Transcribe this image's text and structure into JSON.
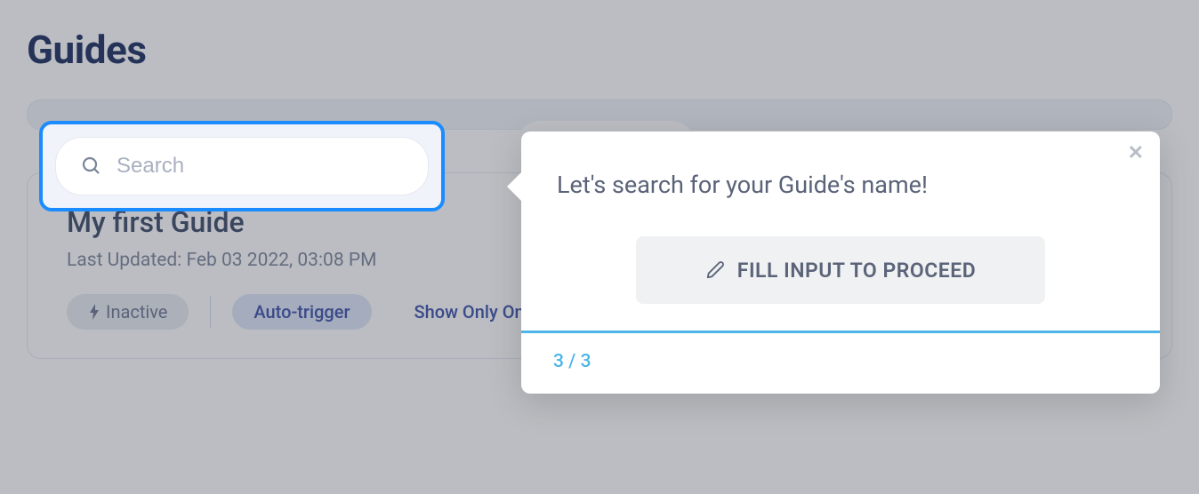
{
  "page": {
    "title": "Guides"
  },
  "search": {
    "placeholder": "Search"
  },
  "guide": {
    "title": "My first Guide",
    "meta_label": "Last Updated: Feb 03 2022, 03:08 PM",
    "badges": {
      "inactive": "Inactive",
      "auto_trigger": "Auto-trigger",
      "show_once": "Show Only Once"
    }
  },
  "tooltip": {
    "title": "Let's search for your Guide's name!",
    "button_label": "FILL INPUT TO PROCEED",
    "step": "3 / 3"
  }
}
